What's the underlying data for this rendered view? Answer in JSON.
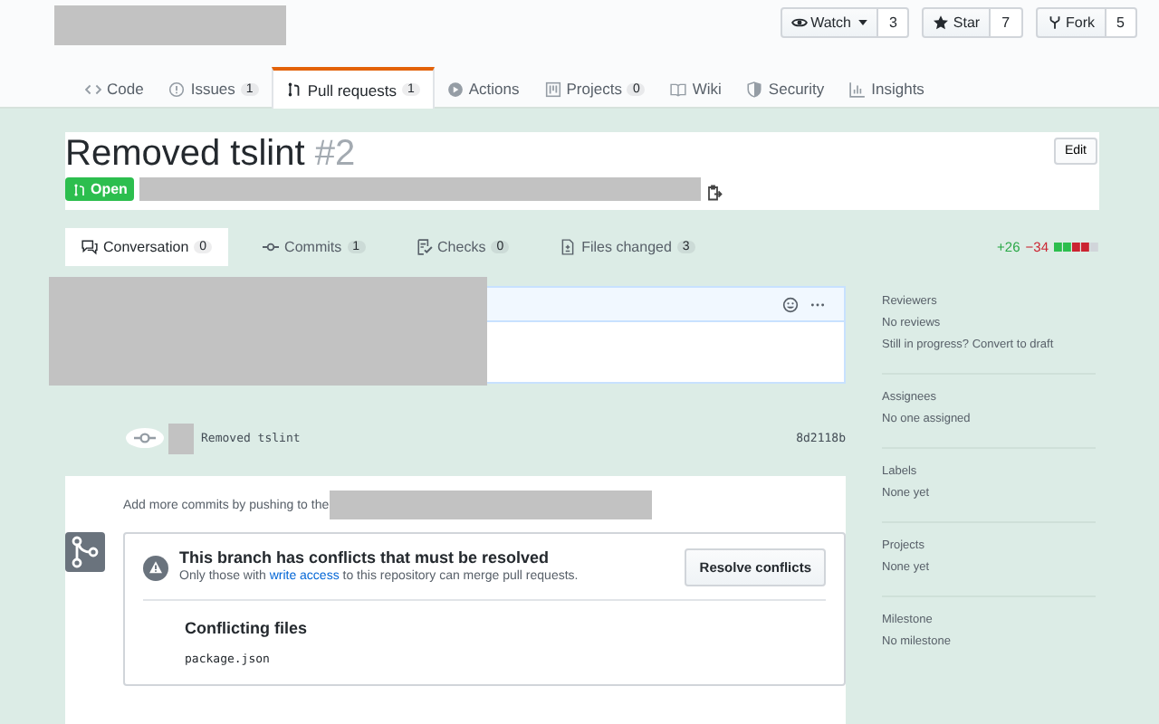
{
  "repo_header": {
    "actions": [
      {
        "label": "Watch",
        "count": "3"
      },
      {
        "label": "Star",
        "count": "7"
      },
      {
        "label": "Fork",
        "count": "5"
      }
    ]
  },
  "repo_tabs": [
    {
      "label": "Code",
      "selected": false
    },
    {
      "label": "Issues",
      "count": "1",
      "selected": false
    },
    {
      "label": "Pull requests",
      "count": "1",
      "selected": true
    },
    {
      "label": "Actions",
      "selected": false
    },
    {
      "label": "Projects",
      "count": "0",
      "selected": false
    },
    {
      "label": "Wiki",
      "selected": false
    },
    {
      "label": "Security",
      "selected": false
    },
    {
      "label": "Insights",
      "selected": false
    }
  ],
  "pull_request": {
    "title": "Removed tslint",
    "number": "#2",
    "status": "Open",
    "edit_button": "Edit"
  },
  "pr_tabs": [
    {
      "label": "Conversation",
      "count": "0",
      "selected": true
    },
    {
      "label": "Commits",
      "count": "1",
      "selected": false
    },
    {
      "label": "Checks",
      "count": "0",
      "selected": false
    },
    {
      "label": "Files changed",
      "count": "3",
      "selected": false
    }
  ],
  "diff_stat": {
    "additions": "+26",
    "deletions": "−34"
  },
  "timeline": {
    "commit": {
      "message": "Removed tslint",
      "sha": "8d2118b"
    },
    "push_hint": "Add more commits by pushing to the",
    "merge_box": {
      "title": "This branch has conflicts that must be resolved",
      "description_before": "Only those with",
      "link": "write access",
      "description_after": "to this repository can merge pull requests.",
      "button": "Resolve conflicts",
      "files_heading": "Conflicting files",
      "files": [
        "package.json"
      ]
    }
  },
  "sidebar": [
    {
      "heading": "Reviewers",
      "lines": [
        "No reviews",
        "Still in progress? Convert to draft"
      ]
    },
    {
      "heading": "Assignees",
      "lines": [
        "No one assigned"
      ]
    },
    {
      "heading": "Labels",
      "lines": [
        "None yet"
      ]
    },
    {
      "heading": "Projects",
      "lines": [
        "None yet"
      ]
    },
    {
      "heading": "Milestone",
      "lines": [
        "No milestone"
      ]
    }
  ]
}
